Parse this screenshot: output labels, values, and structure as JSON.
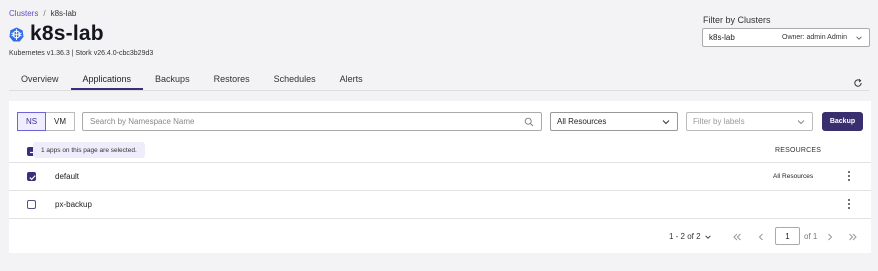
{
  "breadcrumb": {
    "root": "Clusters",
    "separator": "/",
    "current": "k8s-lab"
  },
  "page": {
    "title": "k8s-lab",
    "subtitle": "Kubernetes v1.36.3 | Stork v26.4.0-cbc3b29d3"
  },
  "cluster_filter": {
    "label": "Filter by Clusters",
    "value": "k8s-lab",
    "owner": "Owner: admin Admin"
  },
  "tabs": [
    {
      "label": "Overview",
      "active": false
    },
    {
      "label": "Applications",
      "active": true
    },
    {
      "label": "Backups",
      "active": false
    },
    {
      "label": "Restores",
      "active": false
    },
    {
      "label": "Schedules",
      "active": false
    },
    {
      "label": "Alerts",
      "active": false
    }
  ],
  "toolbar": {
    "ns_label": "NS",
    "vm_label": "VM",
    "search_placeholder": "Search by Namespace Name",
    "resources_select": "All Resources",
    "labels_placeholder": "Filter by labels",
    "backup_label": "Backup"
  },
  "table": {
    "selection_banner": "1 apps on this page are selected.",
    "col_resources": "RESOURCES",
    "rows": [
      {
        "name": "default",
        "resources": "All Resources",
        "checked": true
      },
      {
        "name": "px-backup",
        "resources": "",
        "checked": false
      }
    ]
  },
  "pagination": {
    "range": "1 - 2 of 2",
    "page": "1",
    "of": "of 1"
  },
  "colors": {
    "accent": "#3a2f7f",
    "link": "#5b4fc7",
    "k8s_blue": "#326ce5"
  }
}
